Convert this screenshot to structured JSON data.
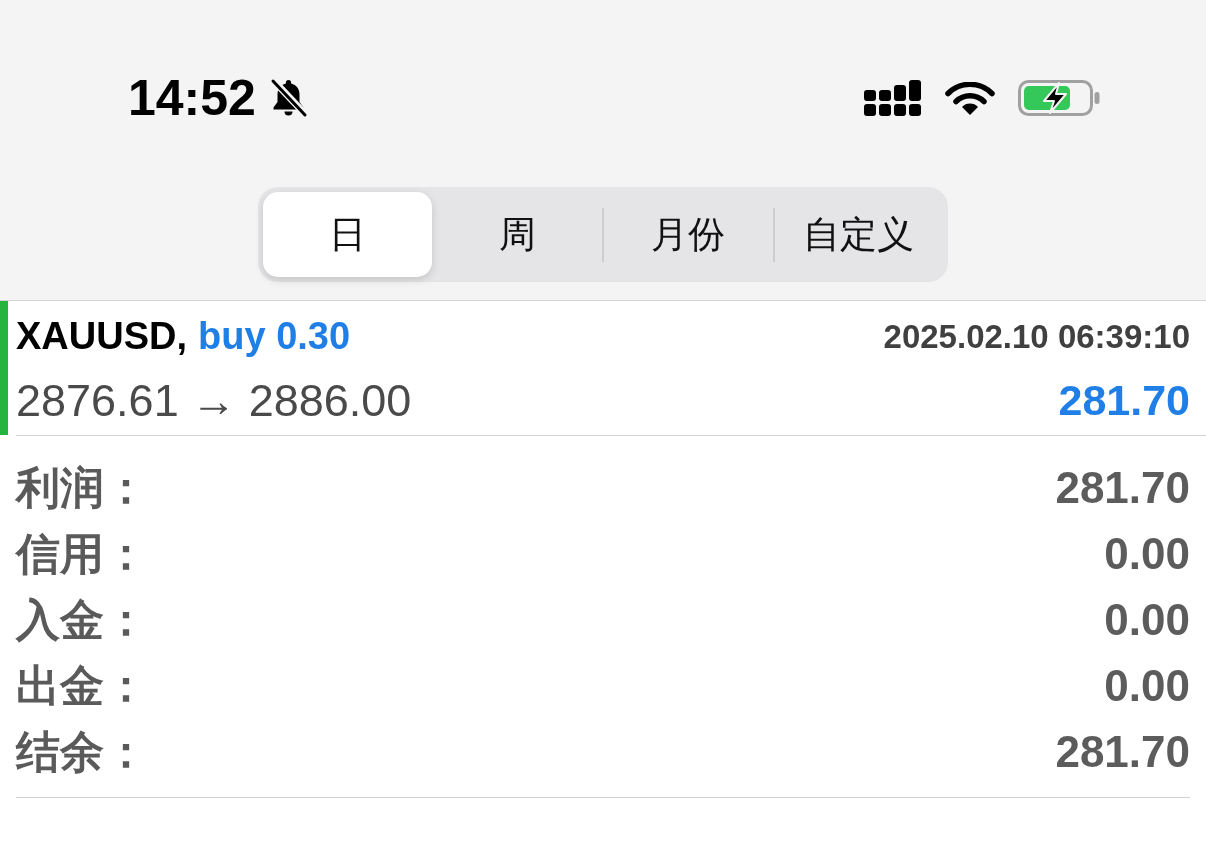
{
  "status_bar": {
    "time": "14:52"
  },
  "period_tabs": [
    {
      "label": "日",
      "selected": true
    },
    {
      "label": "周",
      "selected": false
    },
    {
      "label": "月份",
      "selected": false
    },
    {
      "label": "自定义",
      "selected": false
    }
  ],
  "deals": [
    {
      "symbol": "XAUUSD,",
      "order": "buy 0.30",
      "time": "2025.02.10 06:39:10",
      "prices": "2876.61 → 2886.00",
      "profit": "281.70"
    }
  ],
  "summary": [
    {
      "label": "利润：",
      "value": "281.70"
    },
    {
      "label": "信用：",
      "value": "0.00"
    },
    {
      "label": "入金：",
      "value": "0.00"
    },
    {
      "label": "出金：",
      "value": "0.00"
    },
    {
      "label": "结余：",
      "value": "281.70"
    }
  ]
}
